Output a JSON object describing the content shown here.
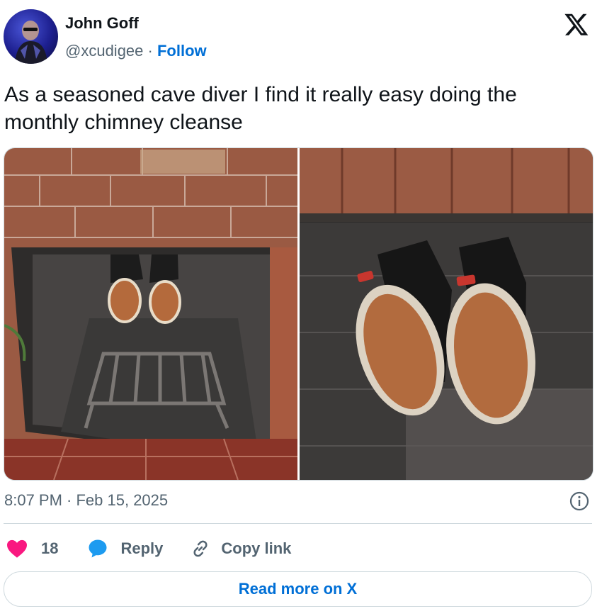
{
  "author": {
    "name": "John Goff",
    "handle": "@xcudigee",
    "separator": " · ",
    "follow_label": "Follow"
  },
  "tweet": {
    "text_line1": "As a seasoned cave diver I find it really easy doing the",
    "text_line2": "monthly chimney cleanse",
    "timestamp": "8:07 PM · Feb 15, 2025"
  },
  "media": [
    {
      "icon": "photo-sneakers-in-fireplace"
    },
    {
      "icon": "photo-sneaker-soles-closeup"
    }
  ],
  "actions": {
    "like_count": "18",
    "reply_label": "Reply",
    "copy_link_label": "Copy link"
  },
  "footer": {
    "read_more_label": "Read more on X"
  },
  "colors": {
    "link_blue": "#006fd6",
    "like_pink": "#f91880",
    "reply_blue": "#1d9bf0",
    "muted_gray": "#536471",
    "border": "#cfd9de"
  }
}
